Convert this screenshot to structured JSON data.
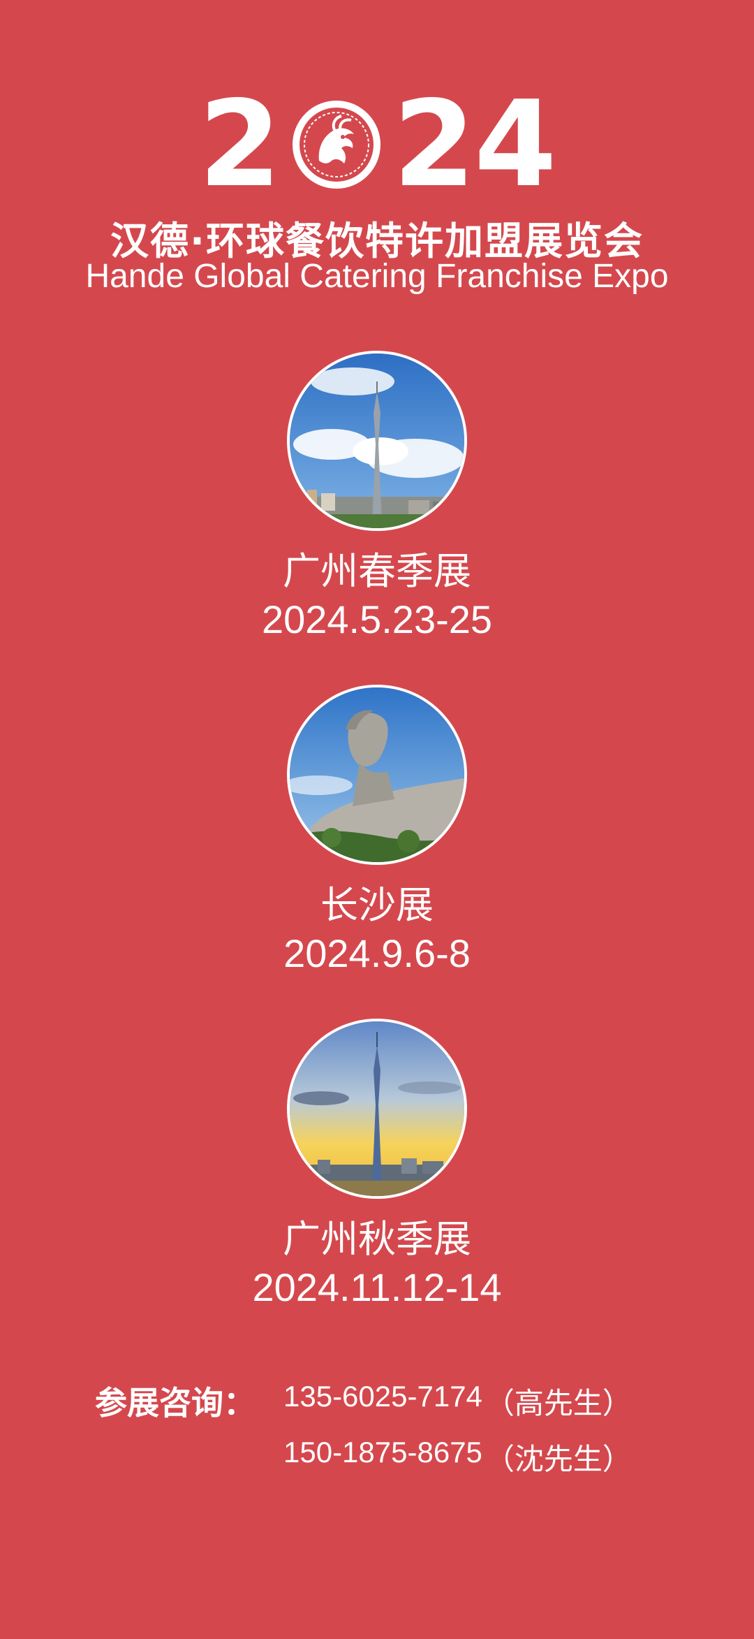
{
  "header": {
    "year_part1": "2",
    "year_part2": "24",
    "title_cn": "汉德·环球餐饮特许加盟展览会",
    "title_en": "Hande Global Catering Franchise Expo"
  },
  "events": [
    {
      "name": "广州春季展",
      "date": "2024.5.23-25",
      "photo": "canton-tower-day"
    },
    {
      "name": "长沙展",
      "date": "2024.9.6-8",
      "photo": "young-mao-statue"
    },
    {
      "name": "广州秋季展",
      "date": "2024.11.12-14",
      "photo": "canton-tower-sunset"
    }
  ],
  "contact": {
    "label": "参展咨询：",
    "phones": [
      {
        "number": "135-6025-7174",
        "person": "（高先生）"
      },
      {
        "number": "150-1875-8675",
        "person": "（沈先生）"
      }
    ]
  },
  "colors": {
    "background": "#d4484d",
    "text": "#ffffff"
  },
  "icons": {
    "emblem": "dragon-emblem-icon"
  }
}
